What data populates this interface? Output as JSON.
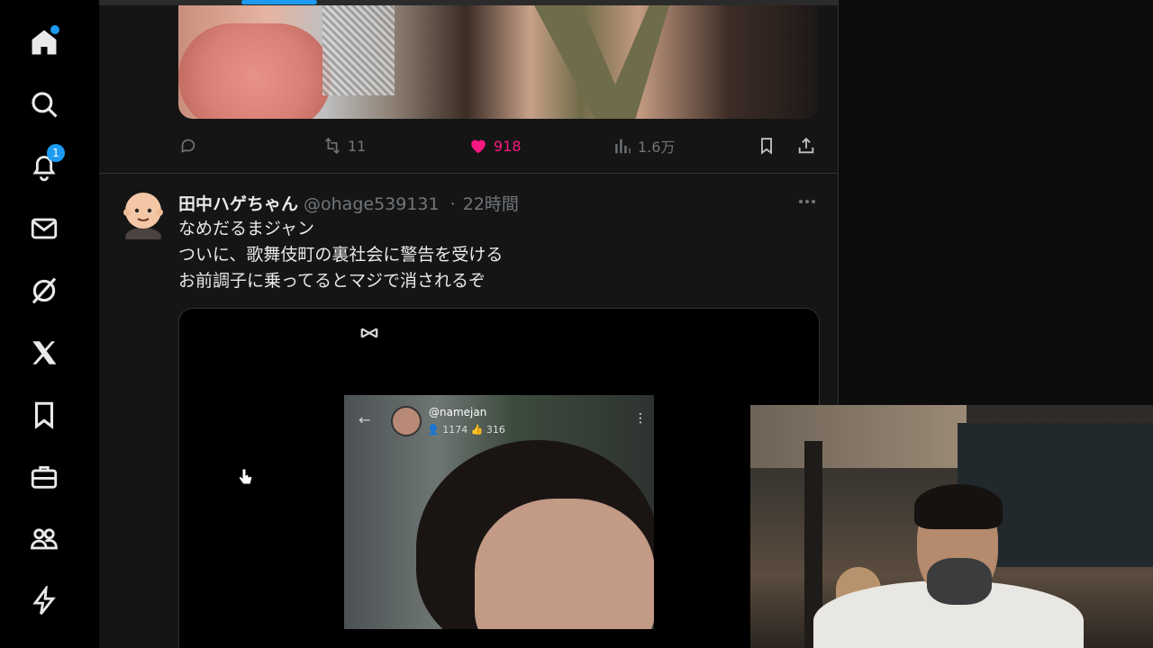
{
  "sidebar": {
    "items": [
      {
        "name": "home",
        "badge": ""
      },
      {
        "name": "explore",
        "badge": ""
      },
      {
        "name": "notifications",
        "badge": "1"
      },
      {
        "name": "messages",
        "badge": ""
      },
      {
        "name": "grok",
        "badge": ""
      },
      {
        "name": "x-premium",
        "badge": ""
      },
      {
        "name": "bookmarks",
        "badge": ""
      },
      {
        "name": "jobs",
        "badge": ""
      },
      {
        "name": "communities",
        "badge": ""
      },
      {
        "name": "verified-orgs",
        "badge": ""
      }
    ]
  },
  "previous_tweet": {
    "reply_count": "",
    "retweet_count": "11",
    "like_count": "918",
    "view_count": "1.6万"
  },
  "tweet": {
    "display_name": "田中ハゲちゃん",
    "handle": "@ohage539131",
    "separator": "·",
    "time": "22時間",
    "lines": [
      "なめだるまジャン",
      "ついに、歌舞伎町の裏社会に警告を受ける",
      "お前調子に乗ってるとマジで消されるぞ"
    ],
    "video": {
      "live_user": "@namejan",
      "viewers": "1174",
      "likes": "316"
    }
  },
  "colors": {
    "accent": "#1d9bf0",
    "like": "#f91880",
    "muted": "#71767b"
  }
}
